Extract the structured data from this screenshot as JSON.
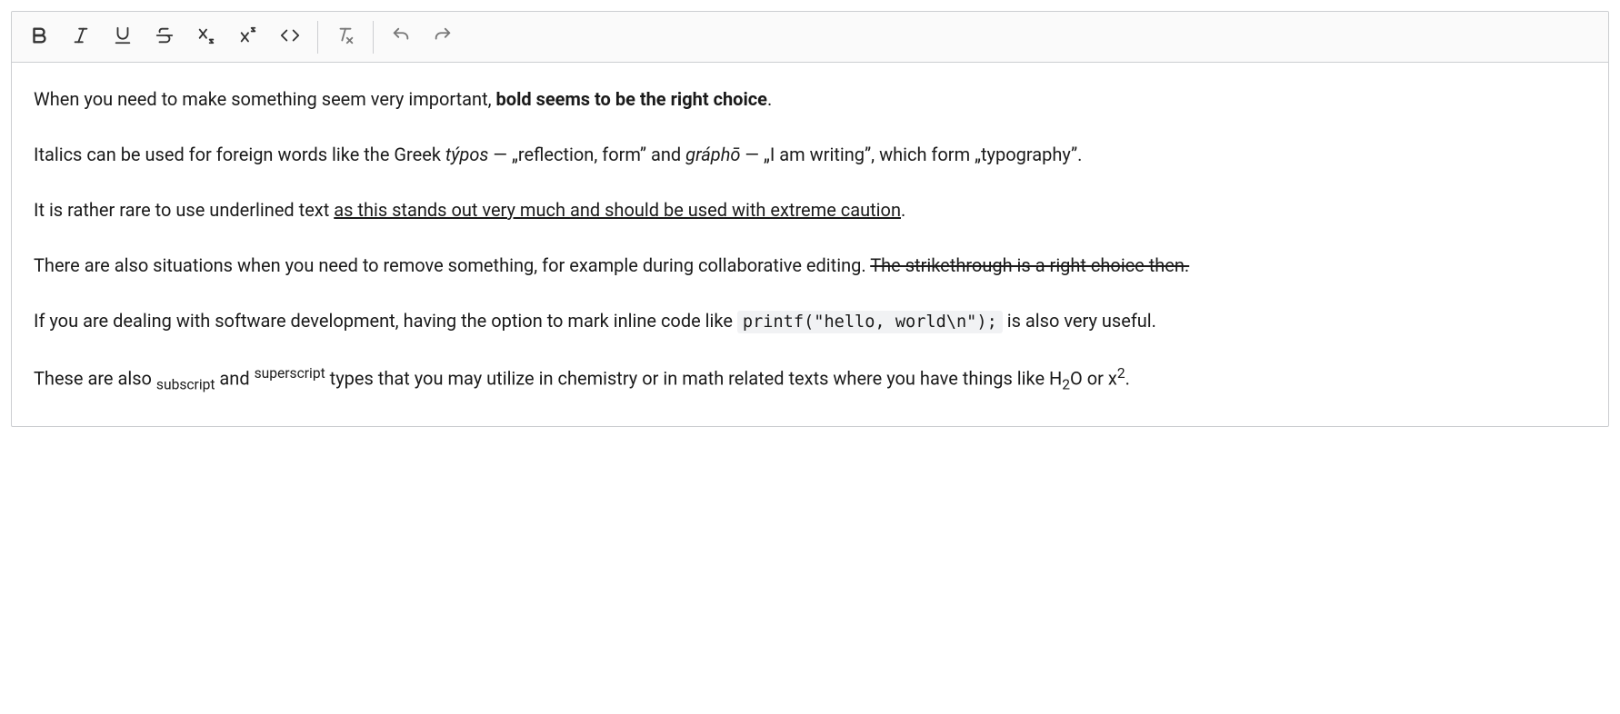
{
  "toolbar": {
    "buttons": [
      {
        "name": "bold-button",
        "icon": "bold-icon"
      },
      {
        "name": "italic-button",
        "icon": "italic-icon"
      },
      {
        "name": "underline-button",
        "icon": "underline-icon"
      },
      {
        "name": "strikethrough-button",
        "icon": "strikethrough-icon"
      },
      {
        "name": "subscript-button",
        "icon": "subscript-icon"
      },
      {
        "name": "superscript-button",
        "icon": "superscript-icon"
      },
      {
        "name": "code-button",
        "icon": "code-icon"
      },
      {
        "name": "remove-format-button",
        "icon": "remove-format-icon"
      },
      {
        "name": "undo-button",
        "icon": "undo-icon"
      },
      {
        "name": "redo-button",
        "icon": "redo-icon"
      }
    ]
  },
  "content": {
    "p1": {
      "t1": "When you need to make something seem very important, ",
      "bold": "bold seems to be the right choice",
      "t2": "."
    },
    "p2": {
      "t1": "Italics can be used for foreign words like the Greek ",
      "it1": "týpos",
      "t2": " — „reflection, form” and ",
      "it2": "gráphō",
      "t3": " — „I am writing”, which form „typography”."
    },
    "p3": {
      "t1": "It is rather rare to use underlined text ",
      "u1": "as this stands out very much and should be used with extreme caution",
      "t2": "."
    },
    "p4": {
      "t1": "There are also situations when you need to remove something, for example during collaborative editing. ",
      "s1": "The strikethrough is a right choice then.",
      "t2": ""
    },
    "p5": {
      "t1": "If you are dealing with software development, having the option to mark inline code like ",
      "code": "printf(\"hello, world\\n\");",
      "t2": " is also very useful."
    },
    "p6": {
      "t1": "These are also ",
      "sub1": "subscript",
      "t2": " and ",
      "sup1": "superscript",
      "t3": " types that you may utilize in chemistry or in math related texts where you have things like H",
      "sub2": "2",
      "t4": "O or x",
      "sup2": "2",
      "t5": "."
    }
  }
}
